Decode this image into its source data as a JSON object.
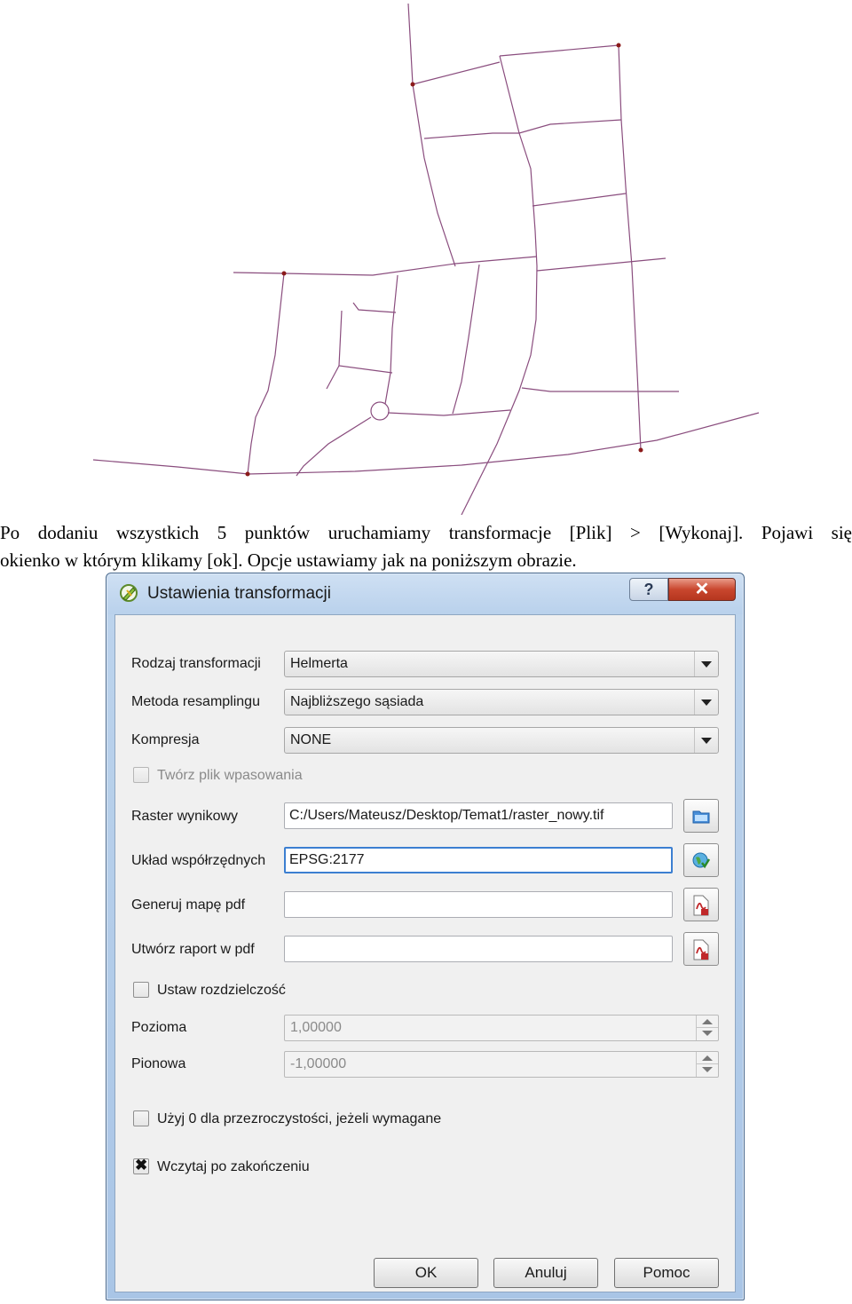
{
  "paragraph": {
    "line1": "Po dodaniu wszystkich 5 punktów uruchamiamy transformacje [Plik] > [Wykonaj]. Pojawi się",
    "line2": "okienko w którym klikamy [ok]. Opcje ustawiamy jak na poniższym obrazie."
  },
  "dialog": {
    "title": "Ustawienia transformacji",
    "help_label": "?",
    "close_label": "✕",
    "transform_type": {
      "label": "Rodzaj transformacji",
      "value": "Helmerta"
    },
    "resampling": {
      "label": "Metoda resamplingu",
      "value": "Najbliższego sąsiada"
    },
    "compression": {
      "label": "Kompresja",
      "value": "NONE"
    },
    "world_file": {
      "label": "Twórz plik wpasowania",
      "checked": false,
      "enabled": false
    },
    "output_raster": {
      "label": "Raster wynikowy",
      "value": "C:/Users/Mateusz/Desktop/Temat1/raster_nowy.tif"
    },
    "crs": {
      "label": "Układ współrzędnych",
      "value": "EPSG:2177"
    },
    "pdf_map": {
      "label": "Generuj mapę pdf",
      "value": ""
    },
    "pdf_report": {
      "label": "Utwórz raport w pdf",
      "value": ""
    },
    "resolution": {
      "label": "Ustaw rozdzielczość",
      "checked": false
    },
    "horizontal": {
      "label": "Pozioma",
      "value": "1,00000"
    },
    "vertical": {
      "label": "Pionowa",
      "value": "-1,00000"
    },
    "transparency": {
      "label": "Użyj 0 dla przezroczystości, jeżeli wymagane",
      "checked": false
    },
    "load_after": {
      "label": "Wczytaj po zakończeniu",
      "checked": true,
      "mark": "✖"
    },
    "buttons": {
      "ok": "OK",
      "cancel": "Anuluj",
      "help": "Pomoc"
    }
  },
  "colors": {
    "map_lines": "#8a4d7e",
    "map_points": "#8b1a1a",
    "dialog_frame": "#b9d1ec",
    "close_button": "#c9472e"
  }
}
